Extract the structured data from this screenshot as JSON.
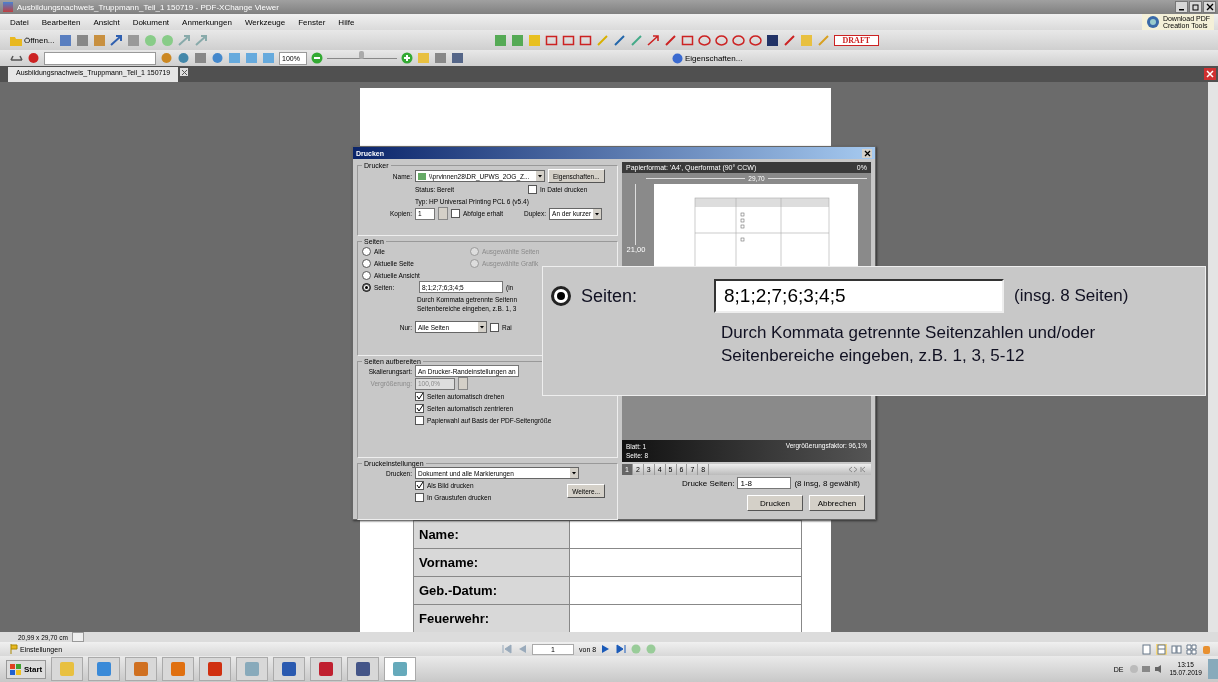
{
  "window": {
    "title": "Ausbildungsnachweis_Truppmann_Teil_1 150719 - PDF-XChange Viewer"
  },
  "promo": {
    "lines": [
      "Download PDF",
      "Creation Tools"
    ]
  },
  "menu": [
    "Datei",
    "Bearbeiten",
    "Ansicht",
    "Dokument",
    "Anmerkungen",
    "Werkzeuge",
    "Fenster",
    "Hilfe"
  ],
  "toolbar": {
    "open_label": "Öffnen...",
    "zoom": "100%",
    "zoom_slider": {
      "level": 0.5
    },
    "stamp": "DRAFT",
    "properties": "Eigenschaften..."
  },
  "document_tab": {
    "label": "Ausbildungsnachweis_Truppmann_Teil_1 150719",
    "selected": true
  },
  "document_form": {
    "rows": [
      "Name:",
      "Vorname:",
      "Geb.-Datum:",
      "Feuerwehr:"
    ]
  },
  "print_dialog": {
    "title": "Drucken",
    "printer": {
      "legend": "Drucker",
      "name_label": "Name:",
      "name_value": "\\\\prvinnen28\\DR_UPWS_2OG_Z...",
      "properties_button": "Eigenschaften...",
      "status": "Status: Bereit",
      "type": "Typ: HP Universal Printing PCL 6 (v5.4)",
      "print_to_file": {
        "label": "In Datei drucken",
        "checked": false
      },
      "copies_label": "Kopien:",
      "copies": "1",
      "collate": {
        "label": "Abfolge erhalt",
        "checked": false
      },
      "duplex_label": "Duplex:",
      "duplex": "An der kurzer"
    },
    "pages": {
      "legend": "Seiten",
      "options": [
        {
          "label": "Alle",
          "selected": false,
          "disabled": false
        },
        {
          "label": "Aktuelle Seite",
          "selected": false,
          "disabled": false
        },
        {
          "label": "Aktuelle Ansicht",
          "selected": false,
          "disabled": false
        },
        {
          "label": "Seiten:",
          "selected": true,
          "disabled": false
        }
      ],
      "selection_options": [
        {
          "label": "Ausgewählte Seiten",
          "selected": false,
          "disabled": true
        },
        {
          "label": "Ausgewählte Grafik",
          "selected": false,
          "disabled": true
        }
      ],
      "range": "8;1;2;7;6;3;4;5",
      "range_note": "(in",
      "hint_lines": [
        "Durch Kommata getrennte Seitenn",
        "Seitenbereiche eingeben, z.B. 1, 3"
      ],
      "only_label": "Nur:",
      "only_value": "Alle Seiten",
      "reverse": {
        "label": "Rai",
        "checked": false
      }
    },
    "prepare": {
      "legend": "Seiten aufbereiten",
      "scaling_label": "Skalierungsart:",
      "scaling": "An Drucker-Randeinstellungen an",
      "zoom_label": "Vergrößerung:",
      "zoom": "100,0%",
      "zoom_disabled": true,
      "checks": [
        {
          "label": "Seiten automatisch drehen",
          "checked": true
        },
        {
          "label": "Seiten automatisch zentrieren",
          "checked": true
        },
        {
          "label": "Papierwahl auf Basis der PDF-Seitengröße",
          "checked": false
        }
      ]
    },
    "settings": {
      "legend": "Druckeinstellungen",
      "print_label": "Drucken:",
      "print_value": "Dokument und alle Markierungen",
      "checks": [
        {
          "label": "Als Bild drucken",
          "checked": true
        },
        {
          "label": "In Graustufen drucken",
          "checked": false
        }
      ],
      "more_button": "Weitere..."
    },
    "preview": {
      "header": "Papierformat: 'A4', Querformat (90° CCW)",
      "zoom_pct": "0%",
      "ruler_h": "29,70",
      "ruler_v": "21,00",
      "sheet": "Blatt: 1",
      "page": "Seite: 8",
      "scale": "Vergrößerungsfaktor: 96,1%",
      "page_tabs": [
        {
          "label": "1",
          "selected": true
        },
        {
          "label": "2",
          "selected": false
        },
        {
          "label": "3",
          "selected": false
        },
        {
          "label": "4",
          "selected": false
        },
        {
          "label": "5",
          "selected": false
        },
        {
          "label": "6",
          "selected": false
        },
        {
          "label": "7",
          "selected": false
        },
        {
          "label": "8",
          "selected": false
        }
      ]
    },
    "print_pages_label": "Drucke Seiten:",
    "print_pages": "1-8",
    "print_pages_note": "(8 insg, 8 gewählt)",
    "buttons": [
      "Drucken",
      "Abbrechen"
    ]
  },
  "callout": {
    "option": {
      "label": "Seiten:",
      "selected": true
    },
    "range": "8;1;2;7;6;3;4;5",
    "note": "(insg. 8 Seiten)",
    "hint": "Durch Kommata getrennte Seitenzahlen und/oder Seitenbereiche eingeben, z.B. 1, 3, 5-12"
  },
  "status": {
    "page_size": "20,99 x 29,70 cm",
    "settings": "Einstellungen",
    "page": "1",
    "of": "von 8"
  },
  "taskbar": {
    "start": "Start",
    "lang": "DE",
    "time": "13:15",
    "date": "15.07.2019"
  }
}
